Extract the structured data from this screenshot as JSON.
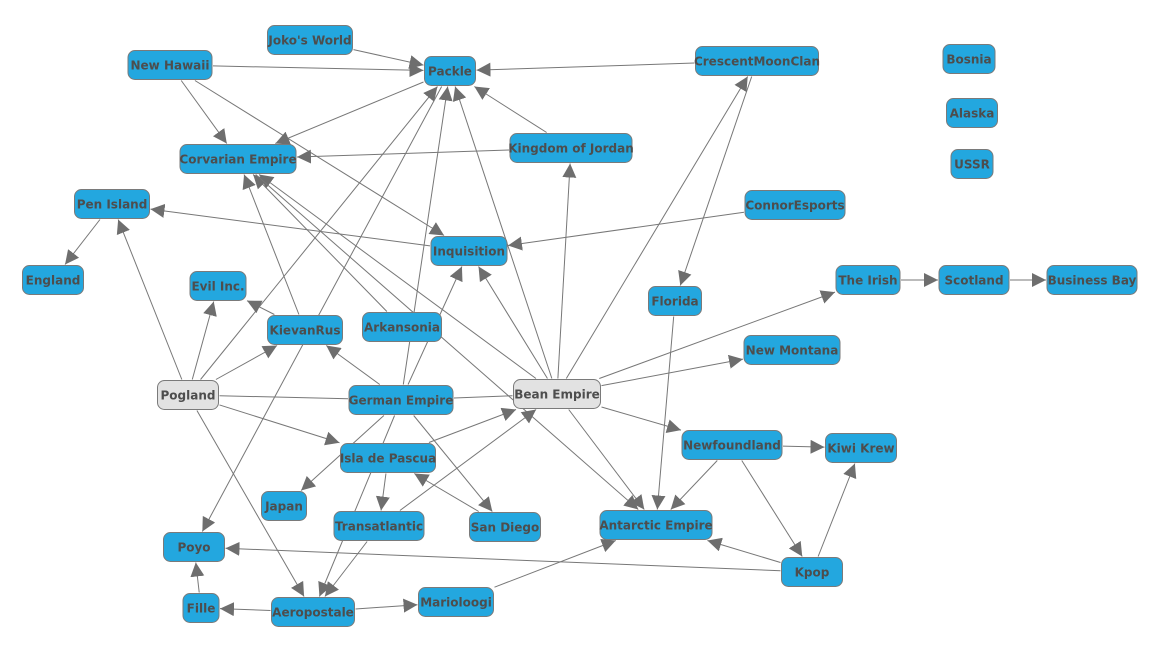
{
  "colors": {
    "node_default": "#23a7df",
    "node_highlight": "#e2e2e2",
    "edge": "#777777",
    "text": "#4d4d4d"
  },
  "nodes": [
    {
      "label": "Joko's World",
      "style": "default"
    },
    {
      "label": "New Hawaii",
      "style": "default"
    },
    {
      "label": "Packle",
      "style": "default"
    },
    {
      "label": "CrescentMoonClan",
      "style": "default"
    },
    {
      "label": "Bosnia",
      "style": "default"
    },
    {
      "label": "Alaska",
      "style": "default"
    },
    {
      "label": "USSR",
      "style": "default"
    },
    {
      "label": "Kingdom of Jordan",
      "style": "default"
    },
    {
      "label": "Corvarian Empire",
      "style": "default"
    },
    {
      "label": "Pen Island",
      "style": "default"
    },
    {
      "label": "ConnorEsports",
      "style": "default"
    },
    {
      "label": "Inquisition",
      "style": "default"
    },
    {
      "label": "England",
      "style": "default"
    },
    {
      "label": "Evil Inc.",
      "style": "default"
    },
    {
      "label": "The Irish",
      "style": "default"
    },
    {
      "label": "Scotland",
      "style": "default"
    },
    {
      "label": "Business Bay",
      "style": "default"
    },
    {
      "label": "Florida",
      "style": "default"
    },
    {
      "label": "KievanRus",
      "style": "default"
    },
    {
      "label": "Arkansonia",
      "style": "default"
    },
    {
      "label": "New Montana",
      "style": "default"
    },
    {
      "label": "Pogland",
      "style": "highlight"
    },
    {
      "label": "German Empire",
      "style": "default"
    },
    {
      "label": "Bean Empire",
      "style": "highlight"
    },
    {
      "label": "Newfoundland",
      "style": "default"
    },
    {
      "label": "Kiwi Krew",
      "style": "default"
    },
    {
      "label": "Isla de Pascua",
      "style": "default"
    },
    {
      "label": "Japan",
      "style": "default"
    },
    {
      "label": "Transatlantic",
      "style": "default"
    },
    {
      "label": "San Diego",
      "style": "default"
    },
    {
      "label": "Antarctic Empire",
      "style": "default"
    },
    {
      "label": "Poyo",
      "style": "default"
    },
    {
      "label": "Kpop",
      "style": "default"
    },
    {
      "label": "Fille",
      "style": "default"
    },
    {
      "label": "Aeropostale",
      "style": "default"
    },
    {
      "label": "Marioloogi",
      "style": "default"
    }
  ],
  "edges": [
    {
      "from": "Joko's World",
      "to": "Packle",
      "directed": true
    },
    {
      "from": "New Hawaii",
      "to": "Packle",
      "directed": true
    },
    {
      "from": "New Hawaii",
      "to": "Corvarian Empire",
      "directed": true
    },
    {
      "from": "New Hawaii",
      "to": "Inquisition",
      "directed": true
    },
    {
      "from": "CrescentMoonClan",
      "to": "Packle",
      "directed": true
    },
    {
      "from": "CrescentMoonClan",
      "to": "Florida",
      "directed": true
    },
    {
      "from": "Bean Empire",
      "to": "CrescentMoonClan",
      "directed": true
    },
    {
      "from": "Kingdom of Jordan",
      "to": "Packle",
      "directed": true
    },
    {
      "from": "Kingdom of Jordan",
      "to": "Corvarian Empire",
      "directed": true
    },
    {
      "from": "Packle",
      "to": "Corvarian Empire",
      "directed": true
    },
    {
      "from": "Inquisition",
      "to": "Pen Island",
      "directed": true
    },
    {
      "from": "ConnorEsports",
      "to": "Inquisition",
      "directed": true
    },
    {
      "from": "Pen Island",
      "to": "England",
      "directed": true
    },
    {
      "from": "Pogland",
      "to": "Pen Island",
      "directed": true
    },
    {
      "from": "Pogland",
      "to": "Evil Inc.",
      "directed": true
    },
    {
      "from": "Pogland",
      "to": "KievanRus",
      "directed": true
    },
    {
      "from": "Pogland",
      "to": "Packle",
      "directed": true
    },
    {
      "from": "Pogland",
      "to": "Isla de Pascua",
      "directed": true
    },
    {
      "from": "Pogland",
      "to": "Aeropostale",
      "directed": true
    },
    {
      "from": "Pogland",
      "to": "German Empire",
      "directed": false
    },
    {
      "from": "German Empire",
      "to": "Bean Empire",
      "directed": false
    },
    {
      "from": "KievanRus",
      "to": "Corvarian Empire",
      "directed": true
    },
    {
      "from": "KievanRus",
      "to": "Evil Inc.",
      "directed": true
    },
    {
      "from": "Packle",
      "to": "Poyo",
      "directed": true
    },
    {
      "from": "Arkansonia",
      "to": "Corvarian Empire",
      "directed": true
    },
    {
      "from": "German Empire",
      "to": "Packle",
      "directed": true
    },
    {
      "from": "German Empire",
      "to": "Inquisition",
      "directed": true
    },
    {
      "from": "German Empire",
      "to": "Japan",
      "directed": true
    },
    {
      "from": "German Empire",
      "to": "San Diego",
      "directed": true
    },
    {
      "from": "German Empire",
      "to": "KievanRus",
      "directed": true
    },
    {
      "from": "German Empire",
      "to": "Aeropostale",
      "directed": true
    },
    {
      "from": "Bean Empire",
      "to": "Inquisition",
      "directed": true
    },
    {
      "from": "Bean Empire",
      "to": "Packle",
      "directed": true
    },
    {
      "from": "Bean Empire",
      "to": "Kingdom of Jordan",
      "directed": true
    },
    {
      "from": "Bean Empire",
      "to": "The Irish",
      "directed": true
    },
    {
      "from": "Bean Empire",
      "to": "New Montana",
      "directed": true
    },
    {
      "from": "Bean Empire",
      "to": "Newfoundland",
      "directed": true
    },
    {
      "from": "Bean Empire",
      "to": "Antarctic Empire",
      "directed": true
    },
    {
      "from": "Bean Empire",
      "to": "Corvarian Empire",
      "directed": true
    },
    {
      "from": "Corvarian Empire",
      "to": "Antarctic Empire",
      "directed": true
    },
    {
      "from": "Isla de Pascua",
      "to": "Transatlantic",
      "directed": true
    },
    {
      "from": "Isla de Pascua",
      "to": "Bean Empire",
      "directed": true
    },
    {
      "from": "San Diego",
      "to": "Isla de Pascua",
      "directed": true
    },
    {
      "from": "Transatlantic",
      "to": "Bean Empire",
      "directed": true
    },
    {
      "from": "Transatlantic",
      "to": "Aeropostale",
      "directed": true
    },
    {
      "from": "Aeropostale",
      "to": "Fille",
      "directed": true
    },
    {
      "from": "Aeropostale",
      "to": "Marioloogi",
      "directed": true
    },
    {
      "from": "Fille",
      "to": "Poyo",
      "directed": true
    },
    {
      "from": "Marioloogi",
      "to": "Antarctic Empire",
      "directed": true
    },
    {
      "from": "Kpop",
      "to": "Poyo",
      "directed": true
    },
    {
      "from": "Kpop",
      "to": "Antarctic Empire",
      "directed": true
    },
    {
      "from": "Kpop",
      "to": "Kiwi Krew",
      "directed": true
    },
    {
      "from": "Newfoundland",
      "to": "Kiwi Krew",
      "directed": true
    },
    {
      "from": "Newfoundland",
      "to": "Kpop",
      "directed": true
    },
    {
      "from": "Newfoundland",
      "to": "Antarctic Empire",
      "directed": true
    },
    {
      "from": "Florida",
      "to": "Antarctic Empire",
      "directed": true
    },
    {
      "from": "The Irish",
      "to": "Scotland",
      "directed": true
    },
    {
      "from": "Scotland",
      "to": "Business Bay",
      "directed": true
    }
  ]
}
